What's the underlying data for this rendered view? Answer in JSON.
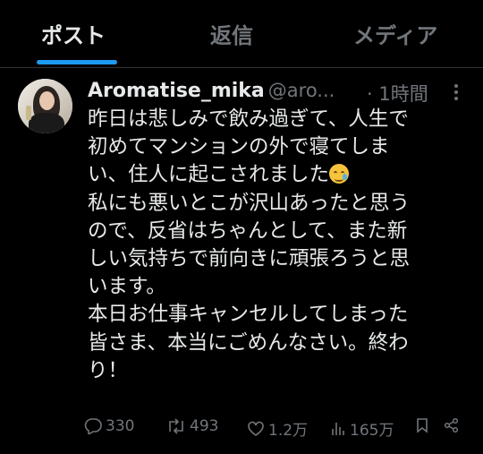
{
  "tabs": [
    {
      "label": "ポスト",
      "active": true
    },
    {
      "label": "返信",
      "active": false
    },
    {
      "label": "メディア",
      "active": false
    }
  ],
  "post": {
    "display_name": "Aromatise_mika",
    "handle": "@aro...",
    "time": "· 1時間",
    "lines": [
      "昨日は悲しみで飲み過ぎて、人生で",
      "初めてマンションの外で寝てしま",
      "い、住人に起こされました",
      "私にも悪いとこが沢山あったと思う",
      "ので、反省はちゃんとして、また新",
      "しい気持ちで前向きに頑張ろうと思",
      "います。",
      "本日お仕事キャンセルしてしまった",
      "皆さま、本当にごめんなさい。終わ",
      "り！"
    ],
    "emoji_icon": "crying-smile-emoji"
  },
  "actions": {
    "replies": "330",
    "reposts": "493",
    "likes": "1.2万",
    "views": "165万"
  },
  "colors": {
    "background": "#000000",
    "text": "#e7e9ea",
    "muted": "#71767b",
    "accent": "#1d9bf0"
  }
}
